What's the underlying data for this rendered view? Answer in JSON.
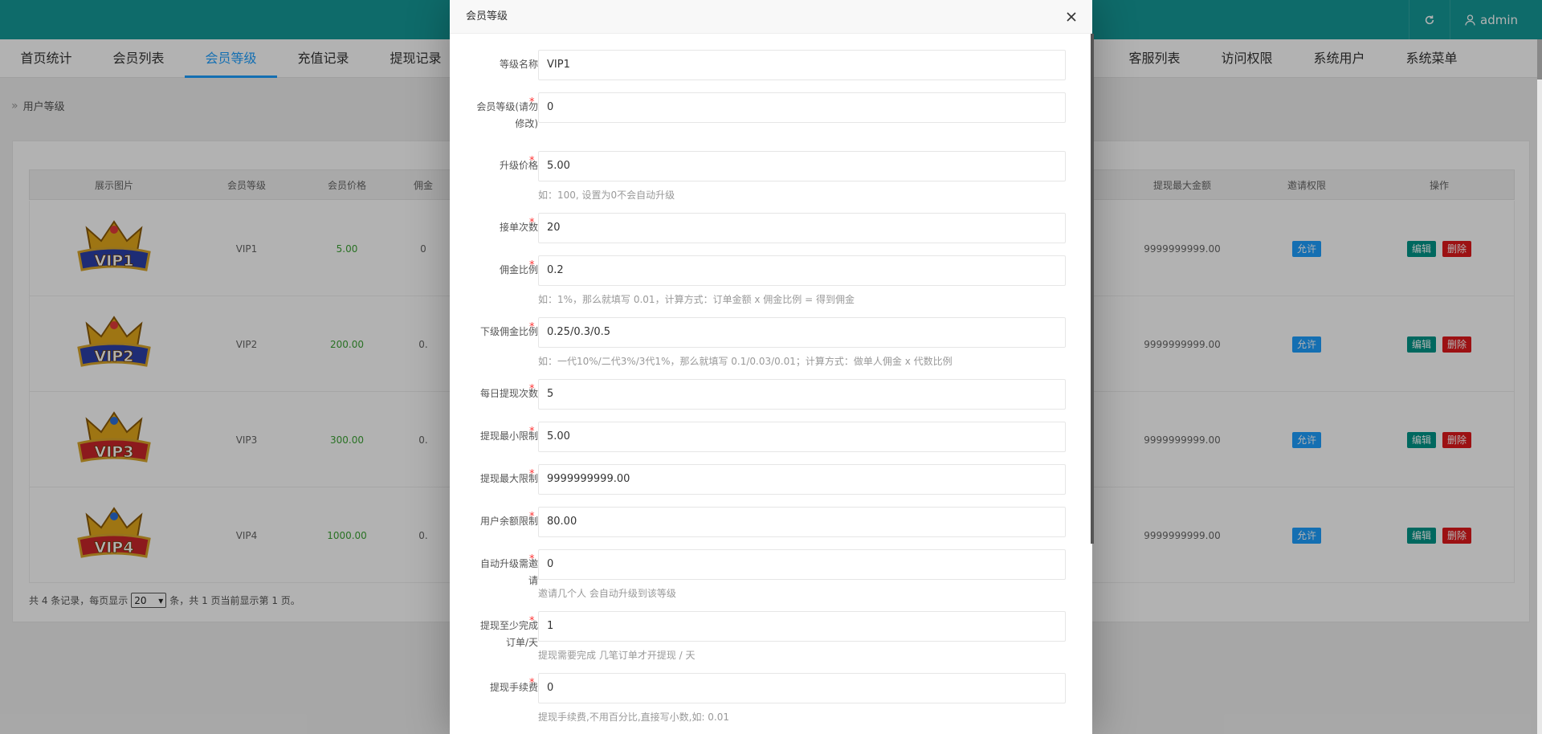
{
  "header": {
    "refresh_icon": "refresh-icon",
    "user_icon": "user-icon",
    "admin_label": "admin"
  },
  "nav": {
    "items": [
      "首页统计",
      "会员列表",
      "会员等级",
      "充值记录",
      "提现记录",
      "客服列表",
      "访问权限",
      "系统用户",
      "系统菜单"
    ],
    "active": "会员等级"
  },
  "breadcrumb": {
    "label": "用户等级"
  },
  "table": {
    "headers": [
      "展示图片",
      "会员等级",
      "会员价格",
      "佣金",
      "提现最大金额",
      "邀请权限",
      "操作"
    ],
    "rows": [
      {
        "badge": "VIP1",
        "level": "VIP1",
        "price": "5.00",
        "comm": "0",
        "max_withdraw": "9999999999.00",
        "invite": "允许",
        "edit": "编辑",
        "delete": "删除"
      },
      {
        "badge": "VIP2",
        "level": "VIP2",
        "price": "200.00",
        "comm": "0.",
        "max_withdraw": "9999999999.00",
        "invite": "允许",
        "edit": "编辑",
        "delete": "删除"
      },
      {
        "badge": "VIP3",
        "level": "VIP3",
        "price": "300.00",
        "comm": "0.",
        "max_withdraw": "9999999999.00",
        "invite": "允许",
        "edit": "编辑",
        "delete": "删除"
      },
      {
        "badge": "VIP4",
        "level": "VIP4",
        "price": "1000.00",
        "comm": "0.",
        "max_withdraw": "9999999999.00",
        "invite": "允许",
        "edit": "编辑",
        "delete": "删除"
      }
    ]
  },
  "pager": {
    "prefix": "共 4 条记录，每页显示",
    "size": "20",
    "suffix": "条，共 1 页当前显示第 1 页。"
  },
  "modal": {
    "title": "会员等级",
    "fields": [
      {
        "label": "等级名称",
        "required": false,
        "value": "VIP1",
        "hint": ""
      },
      {
        "label": "会员等级(请勿修改)",
        "label_l1": "会员等级(请勿",
        "label_l2": "修改)",
        "required": true,
        "value": "0",
        "hint": ""
      },
      {
        "label": "升级价格",
        "required": true,
        "value": "5.00",
        "hint": "如：100, 设置为0不会自动升级"
      },
      {
        "label": "接单次数",
        "required": true,
        "value": "20",
        "hint": ""
      },
      {
        "label": "佣金比例",
        "required": true,
        "value": "0.2",
        "hint": "如：1%，那么就填写 0.01，计算方式：订单金额 x 佣金比例 = 得到佣金"
      },
      {
        "label": "下级佣金比例",
        "required": true,
        "value": "0.25/0.3/0.5",
        "hint": "如：一代10%/二代3%/3代1%，那么就填写 0.1/0.03/0.01；计算方式：做单人佣金 x 代数比例"
      },
      {
        "label": "每日提现次数",
        "required": true,
        "value": "5",
        "hint": ""
      },
      {
        "label": "提现最小限制",
        "required": true,
        "value": "5.00",
        "hint": ""
      },
      {
        "label": "提现最大限制",
        "required": true,
        "value": "9999999999.00",
        "hint": ""
      },
      {
        "label": "用户余额限制",
        "required": true,
        "value": "80.00",
        "hint": ""
      },
      {
        "label": "自动升级需邀请",
        "label_l1": "自动升级需邀",
        "label_l2": "请",
        "required": true,
        "value": "0",
        "hint": "邀请几个人 会自动升级到该等级"
      },
      {
        "label": "提现至少完成订单/天",
        "label_l1": "提现至少完成",
        "label_l2": "订单/天",
        "required": true,
        "value": "1",
        "hint": "提现需要完成 几笔订单才开提现 / 天"
      },
      {
        "label": "提现手续费",
        "required": true,
        "value": "0",
        "hint": "提现手续费,不用百分比,直接写小数,如: 0.01"
      }
    ]
  },
  "colors": {
    "header_bg": "#159a98",
    "active_nav": "#1e9fff",
    "price_green": "#3ca334",
    "btn_blue": "#1e9fff",
    "btn_teal": "#009688",
    "btn_red": "#e0191c"
  }
}
